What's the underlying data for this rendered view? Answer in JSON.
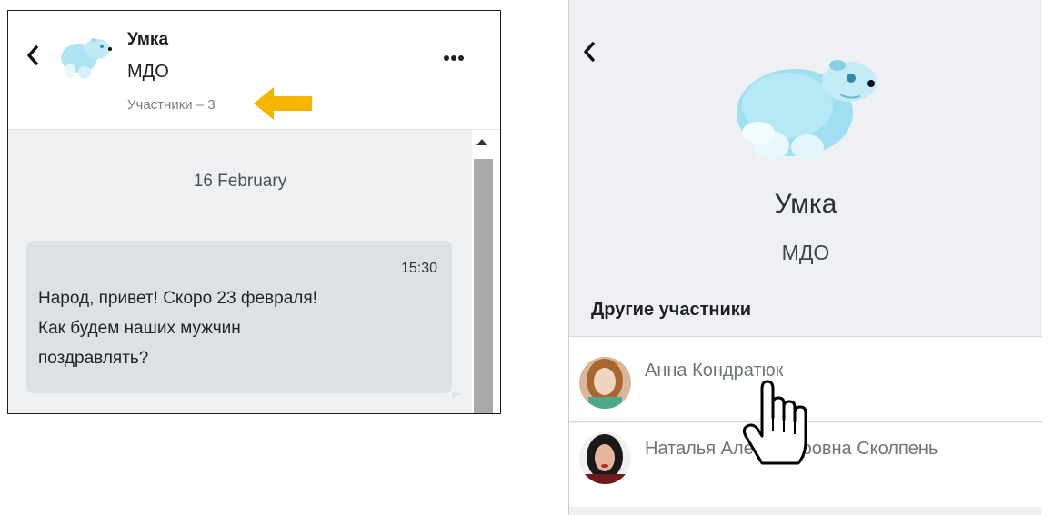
{
  "left": {
    "title": "Умка",
    "subtitle": "МДО",
    "members_link": "Участники – 3",
    "menu_icon": "more-dots-icon",
    "back_icon": "chevron-left-icon",
    "arrow_color": "#f7b500",
    "date_divider": "16 February",
    "message": {
      "time": "15:30",
      "text_lines": [
        "Народ, привет! Скоро 23 февраля!",
        "Как будем наших мужчин",
        "поздравлять?"
      ]
    }
  },
  "right": {
    "back_icon": "chevron-left-icon",
    "title": "Умка",
    "subtitle": "МДО",
    "others_heading": "Другие участники",
    "members": [
      {
        "name": "Анна Кондратюк"
      },
      {
        "name": "Наталья Александровна Сколпень"
      }
    ]
  },
  "colors": {
    "accent_arrow": "#f7b500",
    "chat_bg": "#eff0f2",
    "bubble_bg": "#dde1e6",
    "panel_bg": "#eef0f3"
  }
}
